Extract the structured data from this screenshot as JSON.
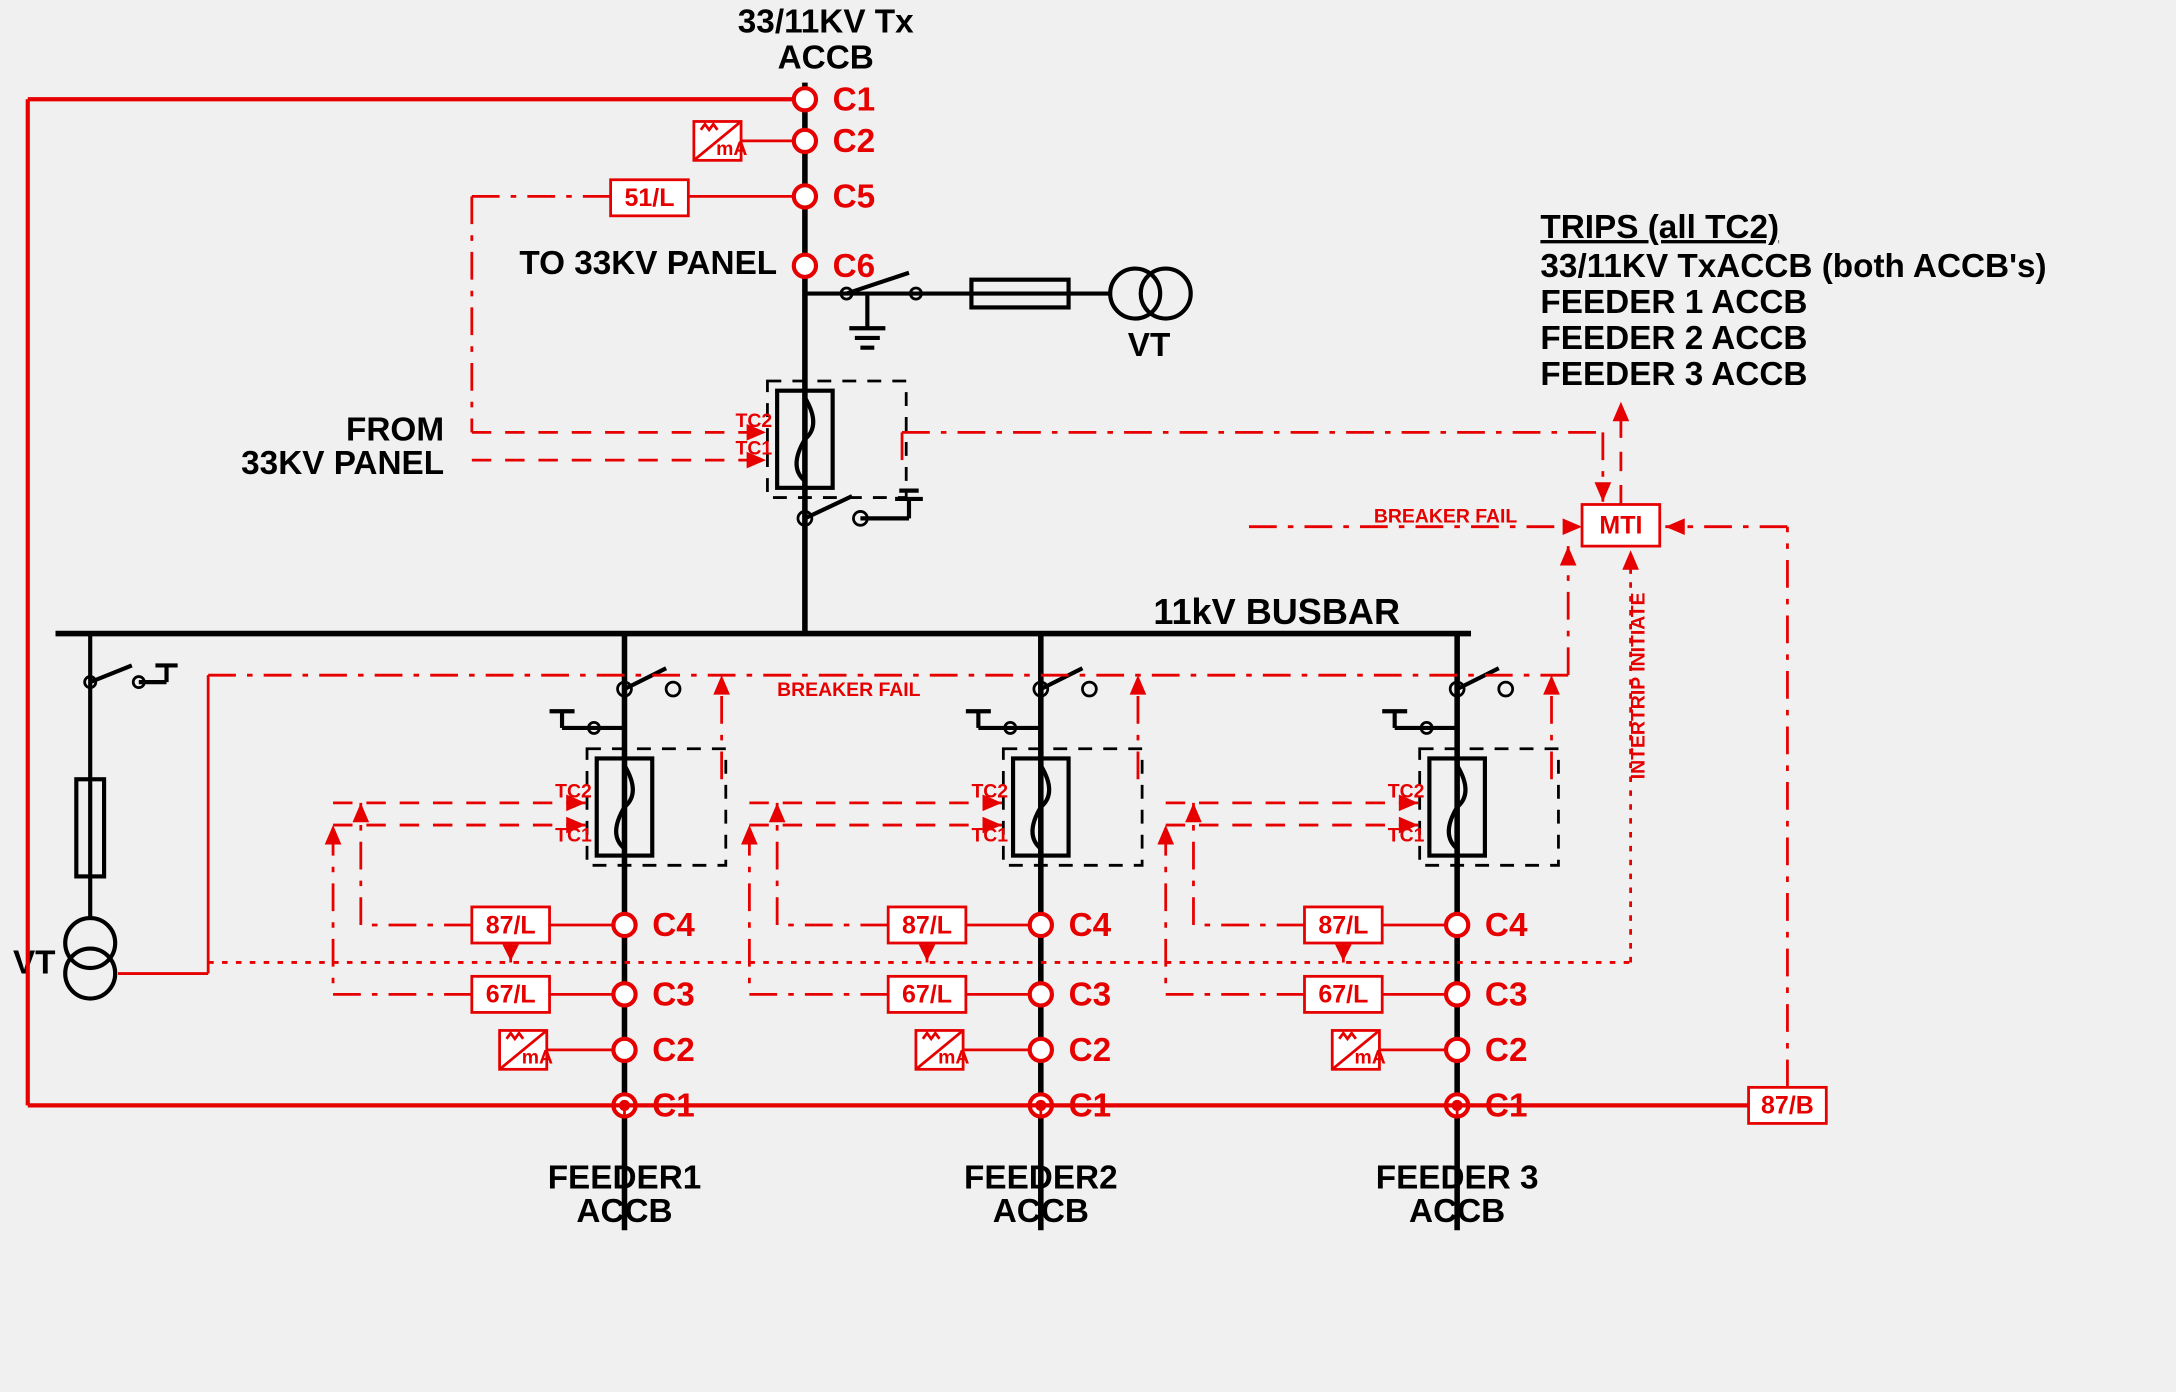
{
  "title_top": "33/11KV Tx",
  "title_top2": "ACCB",
  "to33": "TO 33KV PANEL",
  "from33_a": "FROM",
  "from33_b": "33KV PANEL",
  "busbar": "11kV BUSBAR",
  "vt": "VT",
  "vt2": "VT",
  "relay_51": "51/L",
  "relay_67": "67/L",
  "relay_87L": "87/L",
  "relay_87B": "87/B",
  "mti": "MTI",
  "tc1": "TC1",
  "tc2": "TC2",
  "bf": "BREAKER FAIL",
  "iti": "INTERTRIP INITIATE",
  "ct": {
    "c1": "C1",
    "c2": "C2",
    "c3": "C3",
    "c4": "C4",
    "c5": "C5",
    "c6": "C6"
  },
  "feeder1": "FEEDER1",
  "feeder2": "FEEDER2",
  "feeder3": "FEEDER 3",
  "accb": "ACCB",
  "trips_h": "TRIPS (all TC2)",
  "trips": [
    "33/11KV TxACCB  (both ACCB's)",
    "FEEDER 1 ACCB",
    "FEEDER 2 ACCB",
    "FEEDER 3 ACCB"
  ]
}
